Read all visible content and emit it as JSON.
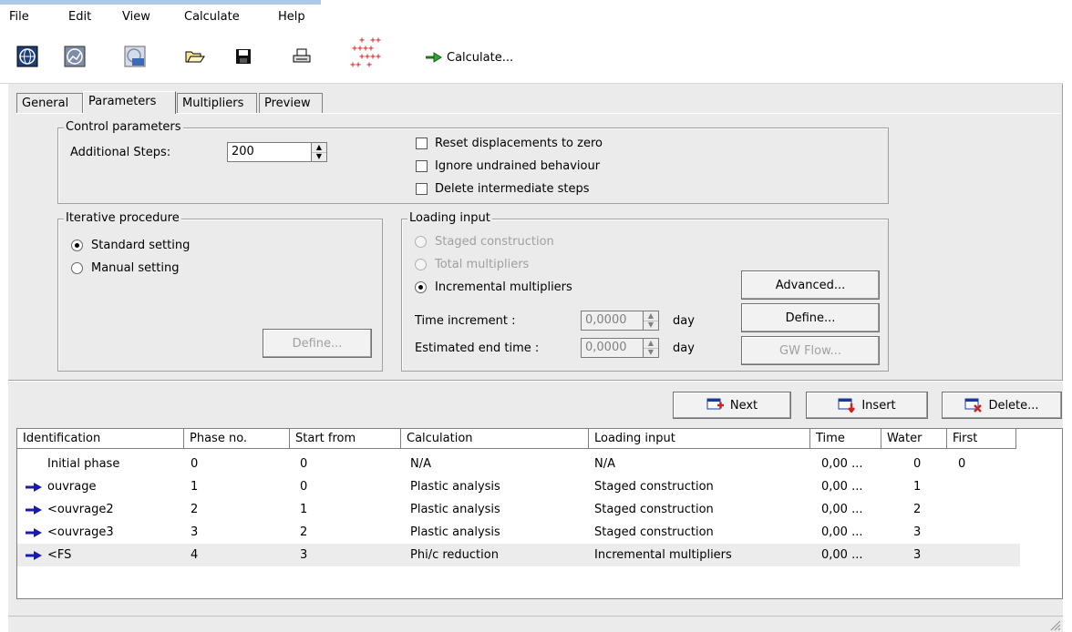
{
  "menu": [
    "File",
    "Edit",
    "View",
    "Calculate",
    "Help"
  ],
  "toolbar": {
    "icons": [
      "globe-icon",
      "globe-chart-icon",
      "globe-output-icon",
      "open-folder-icon",
      "save-icon",
      "print-icon",
      "select-points-icon",
      "calculate-arrow-icon"
    ],
    "calculate_label": "Calculate..."
  },
  "tabs": [
    "General",
    "Parameters",
    "Multipliers",
    "Preview"
  ],
  "control": {
    "title": "Control parameters",
    "steps_label": "Additional Steps:",
    "steps_value": "200",
    "checkboxes": [
      "Reset displacements to zero",
      "Ignore undrained behaviour",
      "Delete intermediate steps"
    ]
  },
  "iterative": {
    "title": "Iterative procedure",
    "options": [
      "Standard setting",
      "Manual setting"
    ],
    "define_label": "Define..."
  },
  "loading": {
    "title": "Loading input",
    "options": [
      "Staged construction",
      "Total multipliers",
      "Incremental multipliers"
    ],
    "time_inc_label": "Time increment :",
    "time_inc_value": "0,0000",
    "end_time_label": "Estimated end time :",
    "end_time_value": "0,0000",
    "unit": "day",
    "advanced_label": "Advanced...",
    "define_label": "Define...",
    "gwflow_label": "GW Flow..."
  },
  "actions": {
    "next": "Next",
    "insert": "Insert",
    "delete": "Delete..."
  },
  "table": {
    "headers": [
      "Identification",
      "Phase no.",
      "Start from",
      "Calculation",
      "Loading input",
      "Time",
      "Water",
      "First"
    ],
    "rows": [
      {
        "id": "Initial phase",
        "phase": "0",
        "start": "0",
        "calc": "N/A",
        "loading": "N/A",
        "time": "0,00 ...",
        "water": "0",
        "first": "0",
        "arrow": false
      },
      {
        "id": "ouvrage",
        "phase": "1",
        "start": "0",
        "calc": "Plastic analysis",
        "loading": "Staged construction",
        "time": "0,00 ...",
        "water": "1",
        "first": "",
        "arrow": true
      },
      {
        "id": "<ouvrage2",
        "phase": "2",
        "start": "1",
        "calc": "Plastic analysis",
        "loading": "Staged construction",
        "time": "0,00 ...",
        "water": "2",
        "first": "",
        "arrow": true
      },
      {
        "id": "<ouvrage3",
        "phase": "3",
        "start": "2",
        "calc": "Plastic analysis",
        "loading": "Staged construction",
        "time": "0,00 ...",
        "water": "3",
        "first": "",
        "arrow": true
      },
      {
        "id": "<FS",
        "phase": "4",
        "start": "3",
        "calc": "Phi/c reduction",
        "loading": "Incremental multipliers",
        "time": "0,00 ...",
        "water": "3",
        "first": "",
        "arrow": true
      }
    ]
  }
}
